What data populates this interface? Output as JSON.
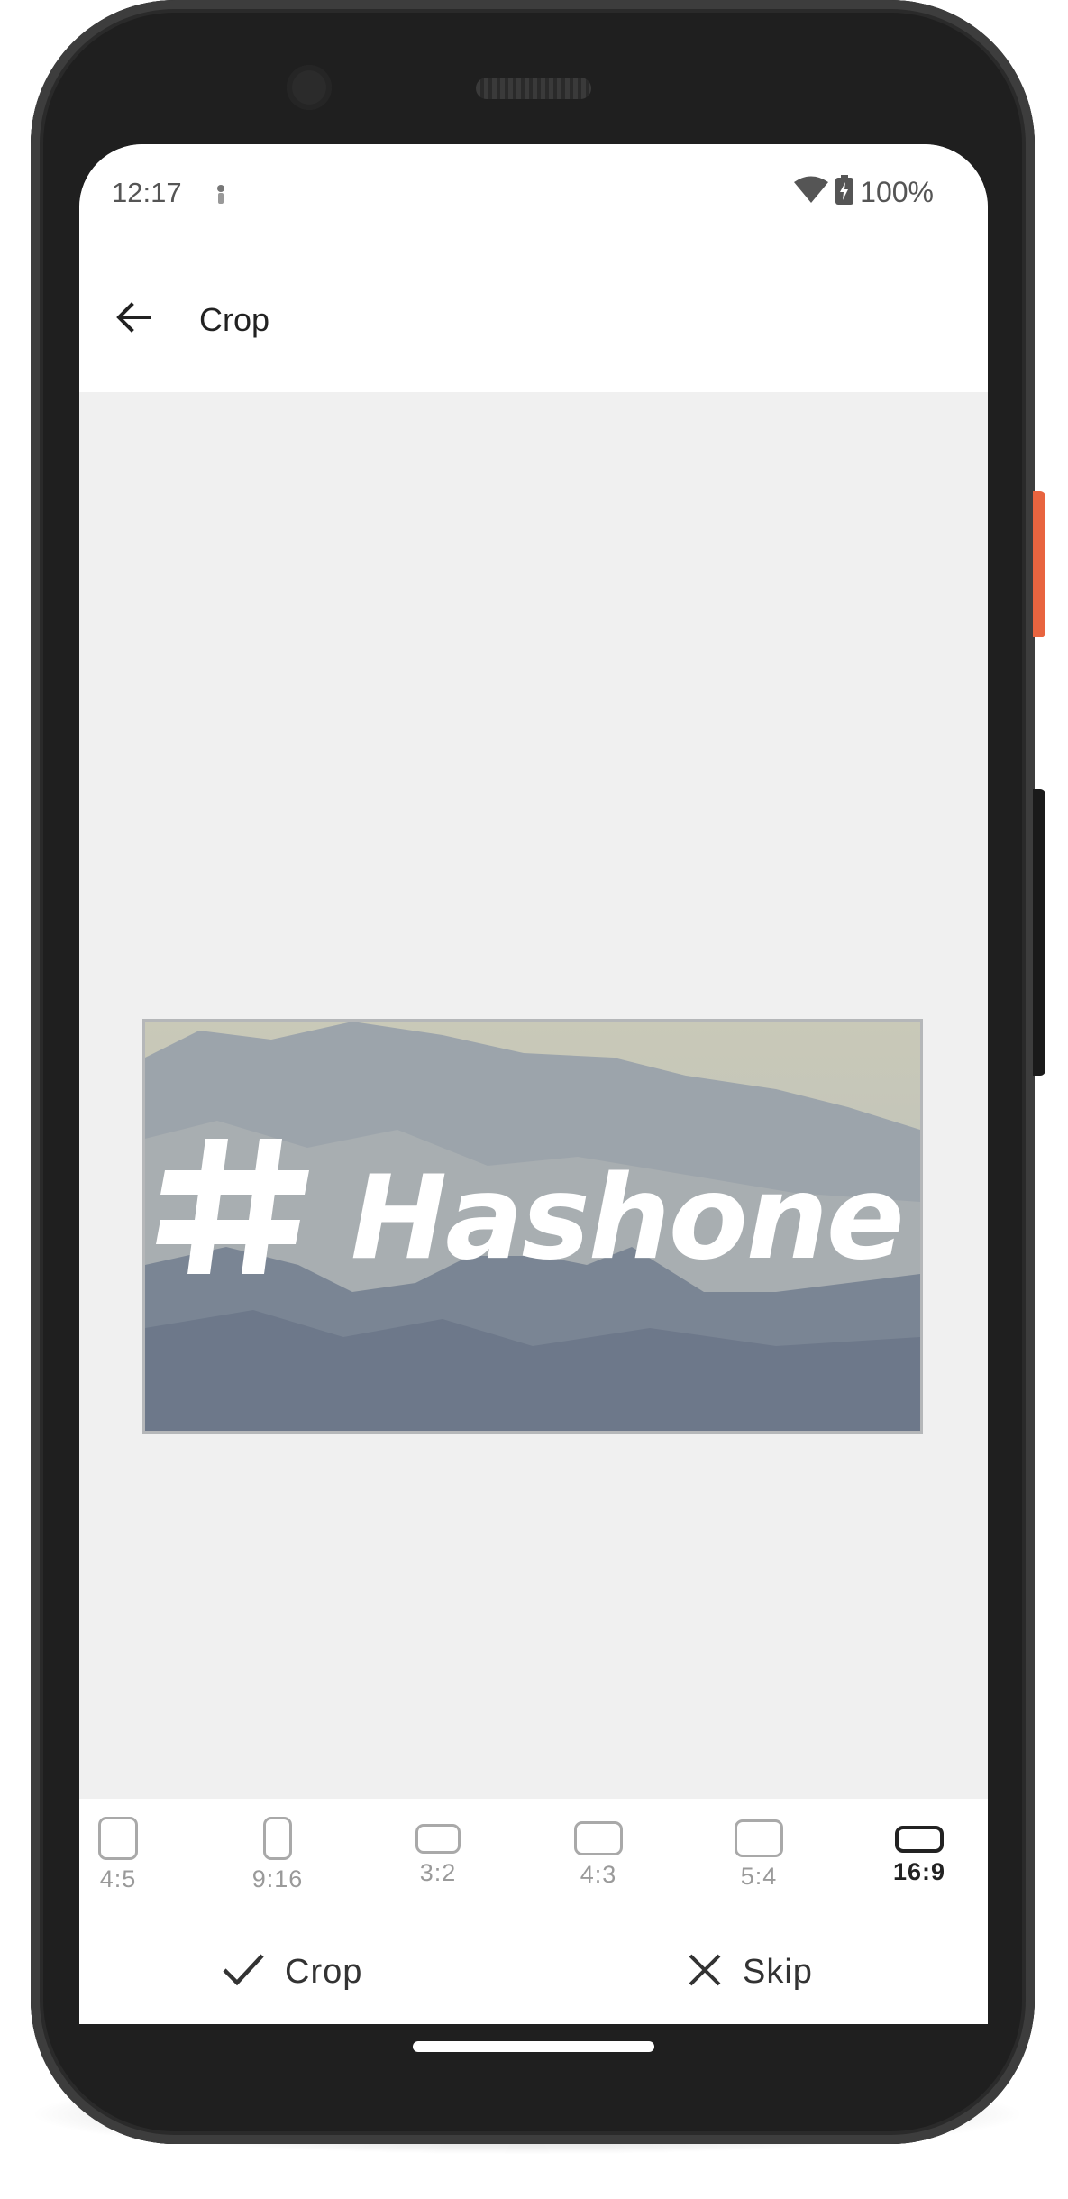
{
  "status_bar": {
    "time": "12:17",
    "battery": "100%",
    "icons": [
      "notification-icon",
      "wifi-icon",
      "battery-charging-icon"
    ]
  },
  "app_bar": {
    "title": "Crop",
    "back_icon": "arrow-left-icon"
  },
  "image": {
    "brand_text": "Hashone",
    "logo_icon": "hash-logo-icon"
  },
  "aspect_ratios": {
    "selected": "16:9",
    "items": [
      {
        "label": "4:5"
      },
      {
        "label": "9:16"
      },
      {
        "label": "3:2"
      },
      {
        "label": "4:3"
      },
      {
        "label": "5:4"
      },
      {
        "label": "16:9"
      }
    ]
  },
  "actions": {
    "crop_label": "Crop",
    "crop_icon": "check-icon",
    "skip_label": "Skip",
    "skip_icon": "close-icon"
  },
  "colors": {
    "accent": "#222222",
    "inactive": "#a9a9a9",
    "canvas": "#f0f0f0",
    "phone_button": "#e8643f"
  }
}
